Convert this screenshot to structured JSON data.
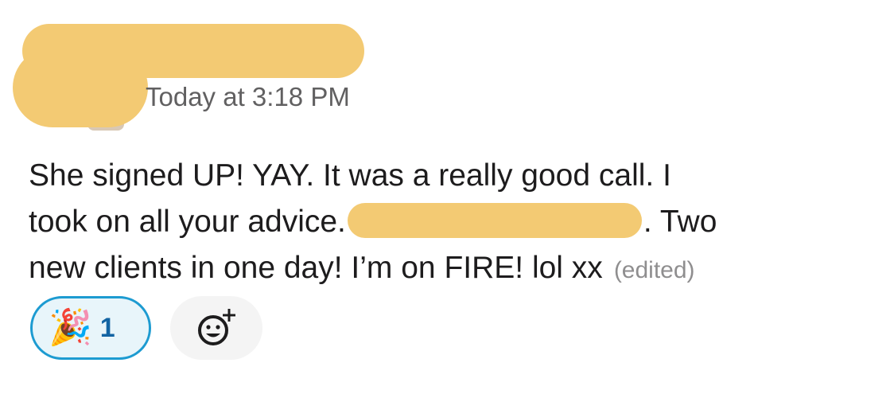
{
  "message": {
    "timestamp": "Today at 3:18 PM",
    "text_line1": "She signed UP! YAY. It was a really good call. I",
    "text_line2_start": "took on all your advice.",
    "text_line2_end": ". Two",
    "text_line3": "new clients in one day! I’m on FIRE! lol xx",
    "edited_label": "(edited)"
  },
  "reactions": [
    {
      "emoji": "🎉",
      "icon": "party-popper-icon",
      "count": "1",
      "selected": true
    }
  ],
  "add_reaction": {
    "icon": "add-reaction-icon"
  },
  "colors": {
    "redaction": "#f3ca73",
    "reaction_border": "#1d9bd1",
    "reaction_bg": "#e8f5fa",
    "reaction_count": "#1264a3",
    "timestamp": "#616061"
  }
}
